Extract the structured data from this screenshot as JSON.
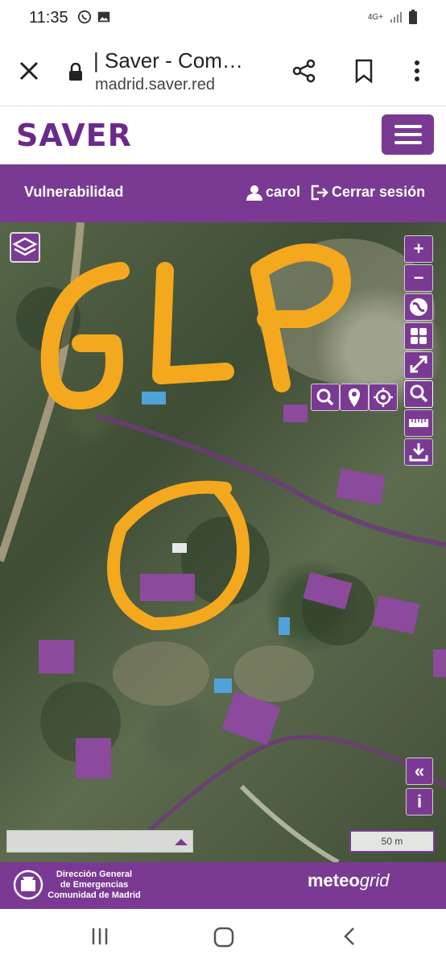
{
  "status_bar": {
    "time": "11:35",
    "network": "4G+",
    "icons": [
      "whatsapp-icon",
      "gallery-icon",
      "signal-icon",
      "battery-icon"
    ]
  },
  "browser": {
    "page_title": "| Saver - Com…",
    "url": "madrid.saver.red",
    "icons": [
      "close-icon",
      "lock-icon",
      "share-icon",
      "bookmark-icon",
      "more-vert-icon"
    ]
  },
  "site": {
    "logo_text": "SAVER",
    "brand_color": "#7a3a94"
  },
  "nav": {
    "section": "Vulnerabilidad",
    "user": "carol",
    "logout": "Cerrar sesión"
  },
  "map": {
    "annotation_text": "GLP",
    "annotation_color": "#f4a81d",
    "controls": {
      "zoom_in": "+",
      "zoom_out": "−",
      "collapse": "«",
      "info": "i"
    },
    "tool_icons": [
      "globe-icon",
      "grid-icon",
      "expand-icon",
      "search-zoom-icon",
      "ruler-icon",
      "download-icon",
      "search-icon",
      "marker-icon",
      "crosshair-icon"
    ],
    "scale_label": "50 m"
  },
  "footer": {
    "org_line1": "Dirección General",
    "org_line2": "de Emergencias",
    "org_line3": "Comunidad de Madrid",
    "partner_a": "meteo",
    "partner_b": "grid"
  }
}
